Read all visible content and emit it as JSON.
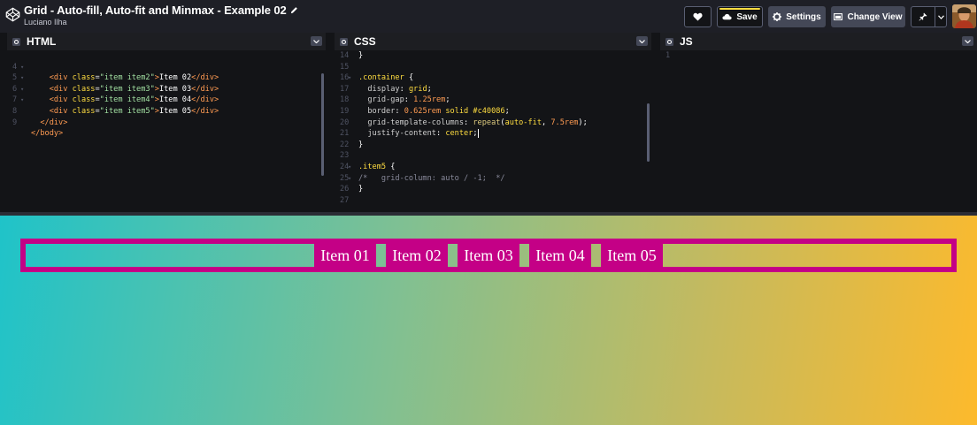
{
  "header": {
    "title": "Grid - Auto-fill, Auto-fit and Minmax - Example 02",
    "author": "Luciano Ilha",
    "buttons": {
      "heart": "",
      "save": "Save",
      "settings": "Settings",
      "change_view": "Change View"
    },
    "icons": [
      "codepen-logo-icon",
      "pencil-icon",
      "heart-icon",
      "cloud-icon",
      "gear-icon",
      "layout-icon",
      "pin-icon",
      "chevron-down-icon",
      "avatar"
    ]
  },
  "editors": {
    "html": {
      "name": "HTML",
      "lines": [
        {
          "n": "4",
          "fold": true,
          "code": "    <div class=\"item item2\">Item 02</div>"
        },
        {
          "n": "5",
          "fold": true,
          "code": "    <div class=\"item item3\">Item 03</div>"
        },
        {
          "n": "6",
          "fold": true,
          "code": "    <div class=\"item item4\">Item 04</div>"
        },
        {
          "n": "7",
          "fold": true,
          "code": "    <div class=\"item item5\">Item 05</div>"
        },
        {
          "n": "8",
          "fold": false,
          "code": "  </div>"
        },
        {
          "n": "9",
          "fold": false,
          "code": "</body>"
        }
      ]
    },
    "css": {
      "name": "CSS",
      "lines": [
        {
          "n": "14",
          "fold": false,
          "code": "}"
        },
        {
          "n": "15",
          "fold": false,
          "code": ""
        },
        {
          "n": "16",
          "fold": true,
          "code": ".container {"
        },
        {
          "n": "17",
          "fold": false,
          "code": "  display: grid;"
        },
        {
          "n": "18",
          "fold": false,
          "code": "  grid-gap: 1.25rem;"
        },
        {
          "n": "19",
          "fold": false,
          "code": "  border: 0.625rem solid #c40086;"
        },
        {
          "n": "20",
          "fold": false,
          "code": "  grid-template-columns: repeat(auto-fit, 7.5rem);"
        },
        {
          "n": "21",
          "fold": false,
          "code": "  justify-content: center;"
        },
        {
          "n": "22",
          "fold": false,
          "code": "}"
        },
        {
          "n": "23",
          "fold": false,
          "code": ""
        },
        {
          "n": "24",
          "fold": true,
          "code": ".item5 {"
        },
        {
          "n": "25",
          "fold": true,
          "code": "/*   grid-column: auto / -1;  */"
        },
        {
          "n": "26",
          "fold": false,
          "code": "}"
        },
        {
          "n": "27",
          "fold": false,
          "code": ""
        }
      ]
    },
    "js": {
      "name": "JS",
      "lines": [
        {
          "n": "1",
          "fold": false,
          "code": ""
        }
      ]
    }
  },
  "preview": {
    "items": [
      "Item 01",
      "Item 02",
      "Item 03",
      "Item 04",
      "Item 05"
    ],
    "colors": {
      "border": "#c40086",
      "item": "#c40086",
      "gradient_start": "#1fc3c9",
      "gradient_end": "#fdba2c"
    }
  }
}
